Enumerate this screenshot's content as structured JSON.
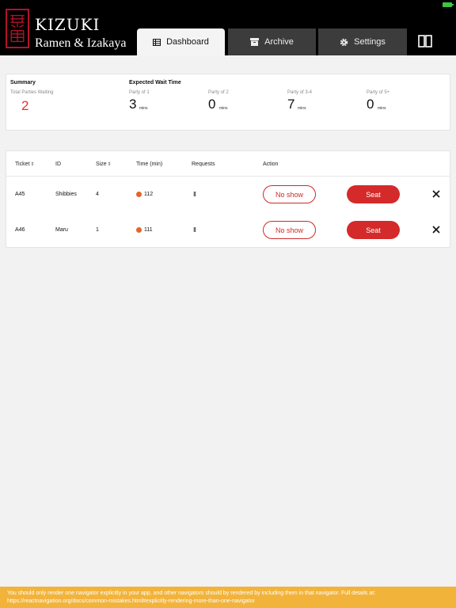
{
  "brand": {
    "title": "KIZUKI",
    "subtitle": "Ramen & Izakaya"
  },
  "tabs": [
    {
      "label": "Dashboard",
      "icon": "table-icon",
      "active": true
    },
    {
      "label": "Archive",
      "icon": "archive-icon",
      "active": false
    },
    {
      "label": "Settings",
      "icon": "gear-icon",
      "active": false
    }
  ],
  "summary": {
    "heading": "Summary",
    "total_label": "Total Parties Waiting",
    "total_value": "2",
    "wait_heading": "Expected Wait Time",
    "unit": "mins",
    "parties": [
      {
        "label": "Party of 1",
        "value": "3"
      },
      {
        "label": "Party of 2",
        "value": "0"
      },
      {
        "label": "Party of 3-4",
        "value": "7"
      },
      {
        "label": "Party of 5+",
        "value": "0"
      }
    ]
  },
  "table": {
    "columns": [
      "Ticket",
      "ID",
      "Size",
      "Time (min)",
      "Requests",
      "Action"
    ],
    "rows": [
      {
        "ticket": "A45",
        "id": "Shibbies",
        "size": "4",
        "time": "112",
        "request_icon": "chair-icon",
        "noshow": "No show",
        "seat": "Seat"
      },
      {
        "ticket": "A46",
        "id": "Maru",
        "size": "1",
        "time": "111",
        "request_icon": "chair-icon",
        "noshow": "No show",
        "seat": "Seat"
      }
    ]
  },
  "colors": {
    "accent_red": "#d42a2a",
    "time_dot": "#e3652b",
    "warning": "#f2b33b"
  },
  "warning": {
    "text": "You should only render one navigator explicitly in your app, and other navigators should by rendered by including them in that navigator. Full details at: https://reactnavigation.org/docs/common-mistakes.html#explicitly-rendering-more-than-one-navigator"
  }
}
